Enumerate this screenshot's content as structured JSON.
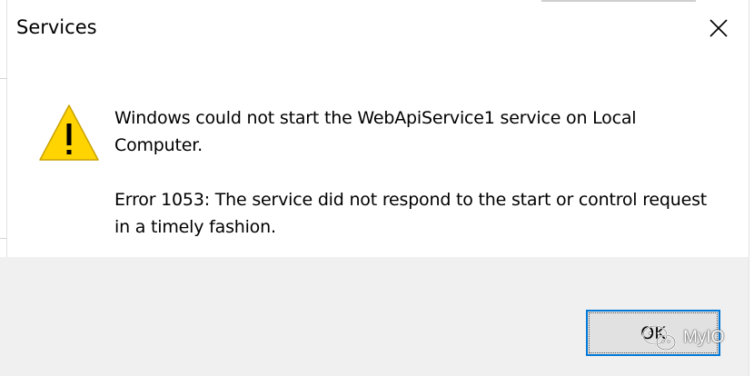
{
  "dialog": {
    "title": "Services",
    "close_icon": "close-icon",
    "icon": "warning-icon",
    "message_line1": "Windows could not start the WebApiService1 service on Local Computer.",
    "message_line2": "Error 1053: The service did not respond to the start or control request in a timely fashion.",
    "ok_label": "OK"
  },
  "watermark": {
    "icon": "wechat-icon",
    "text": "MyIO"
  },
  "colors": {
    "accent": "#0078d7",
    "warning": "#ffd400",
    "footer_bg": "#f0f0f0",
    "button_bg": "#e1e1e1"
  }
}
